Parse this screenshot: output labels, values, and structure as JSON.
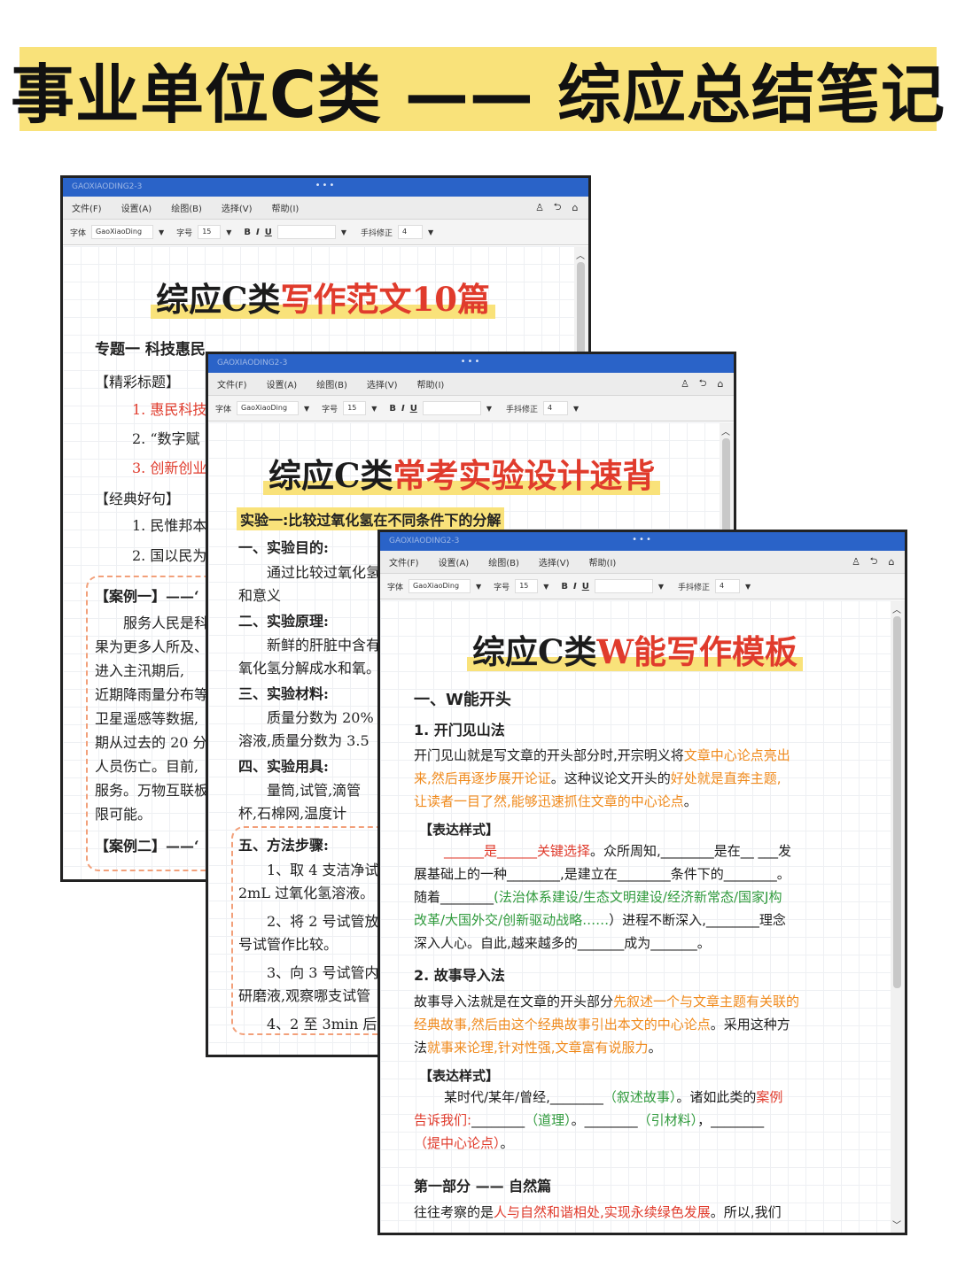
{
  "banner": {
    "title": "事业单位C类 —— 综应总结笔记"
  },
  "window_common": {
    "app_name": "GAOXIAODING2-3",
    "menu": [
      "文件(F)",
      "设置(A)",
      "绘图(B)",
      "选择(V)",
      "帮助(I)"
    ],
    "toolbar": {
      "font_label": "字体",
      "font_value": "GaoXiaoDing",
      "size_label": "字号",
      "size_value": "15",
      "bold": "B",
      "italic": "I",
      "underline": "U",
      "handwrite_label": "手抖修正",
      "handwrite_value": "4"
    },
    "icons": [
      "user-icon",
      "undo-icon",
      "home-icon"
    ]
  },
  "win1": {
    "title_black": "综应C类",
    "title_red": "写作范文10篇",
    "topic": "专题一  科技惠民",
    "sec_title": "【精彩标题】",
    "items": [
      "1. 惠民科技",
      "2. “数字赋",
      "3. 创新创业"
    ],
    "sec_quote": "【经典好句】",
    "quotes": [
      "1. 民惟邦本",
      "2. 国以民为"
    ],
    "case1": "【案例一】——‘",
    "case1_lines": [
      "服务人民是科",
      "果为更多人所及、",
      "进入主汛期后,",
      "近期降雨量分布等",
      "卫星遥感等数据,",
      "期从过去的 20 分",
      "人员伤亡。目前,",
      "服务。万物互联板",
      "限可能。"
    ],
    "case2": "【案例二】——‘"
  },
  "win2": {
    "title_black": "综应C类",
    "title_red": "常考实验设计速背",
    "exp": "实验一:比较过氧化氢在不同条件下的分解",
    "s1": "一、实验目的:",
    "s1_lines": [
      "通过比较过氧化氢",
      "和意义"
    ],
    "s2": "二、实验原理:",
    "s2_lines": [
      "新鲜的肝脏中含有",
      "氧化氢分解成水和氧。"
    ],
    "s3": "三、实验材料:",
    "s3_lines": [
      "质量分数为 20%",
      "溶液,质量分数为 3.5"
    ],
    "s4": "四、实验用具:",
    "s4_lines": [
      "量筒,试管,滴管",
      "杯,石棉网,温度计"
    ],
    "s5": "五、方法步骤:",
    "s5_lines": [
      "1、取 4 支洁净试",
      "2mL 过氧化氢溶液。",
      "2、将 2 号试管放",
      "号试管作比较。",
      "3、向 3 号试管内",
      "研磨液,观察哪支试管",
      "4、2 至 3min 后,"
    ]
  },
  "win3": {
    "title_black": "综应C类",
    "title_red": "W能写作模板",
    "h1": "一、W能开头",
    "h2a": "1. 开门见山法",
    "p1": [
      [
        [
          "开门见山就是写文章的开头部分时,开宗明义将",
          "black"
        ],
        [
          "文章中心论点亮出",
          "orange"
        ]
      ],
      [
        [
          "来,然后再逐步展开论证",
          "orange"
        ],
        [
          "。这种议论文开头的",
          "black"
        ],
        [
          "好处就是直奔主题,",
          "orange"
        ]
      ],
      [
        [
          "让读者一目了然,能够迅速抓住文章的中心论点",
          "orange"
        ],
        [
          "。",
          "black"
        ]
      ]
    ],
    "style_label": "【表达样式】",
    "t1": [
      [
        [
          "______是______关键选择",
          "red"
        ],
        [
          "。众所周知,________是在__ ___发",
          "black"
        ]
      ],
      [
        [
          "展基础上的一种________,是建立在________条件下的________。",
          "black"
        ]
      ],
      [
        [
          "随着________",
          "black"
        ],
        [
          "(法治体系建设/生态文明建设/经济新常态/国家J构",
          "green"
        ]
      ],
      [
        [
          "改革/大国外交/创新驱动战略……",
          "green"
        ],
        [
          "）进程不断深入,________理念",
          "black"
        ]
      ],
      [
        [
          "深入人心。自此,越来越多的_______成为_______。",
          "black"
        ]
      ]
    ],
    "h2b": "2. 故事导入法",
    "p2": [
      [
        [
          "故事导入法就是在文章的开头部分",
          "black"
        ],
        [
          "先叙述一个与文章主题有关联的",
          "orange"
        ]
      ],
      [
        [
          "经典故事,然后由这个经典故事引出本文的中心论点",
          "orange"
        ],
        [
          "。采用这种方",
          "black"
        ]
      ],
      [
        [
          "法",
          "black"
        ],
        [
          "就事来论理,针对性强,文章富有说服力",
          "orange"
        ],
        [
          "。",
          "black"
        ]
      ]
    ],
    "style_label2": "【表达样式】",
    "t2": [
      [
        [
          "某时代/某年/曾经,________",
          "black"
        ],
        [
          "（叙述故事）",
          "green"
        ],
        [
          "。诸如此类的",
          "black"
        ],
        [
          "案例",
          "red"
        ]
      ],
      [
        [
          "告诉我们:",
          "red"
        ],
        [
          "________",
          "black"
        ],
        [
          "（道理）",
          "green"
        ],
        [
          "。________",
          "black"
        ],
        [
          "（引材料）",
          "green"
        ],
        [
          "，________",
          "black"
        ]
      ],
      [
        [
          "（提中心论点）",
          "red"
        ],
        [
          "。",
          "black"
        ]
      ]
    ],
    "part1": "第一部分 —— 自然篇",
    "p3": [
      [
        [
          "往往考察的是",
          "black"
        ],
        [
          "人与自然和谐相处,实现永续绿色发展",
          "red"
        ],
        [
          "。所以,我们",
          "black"
        ]
      ]
    ]
  }
}
